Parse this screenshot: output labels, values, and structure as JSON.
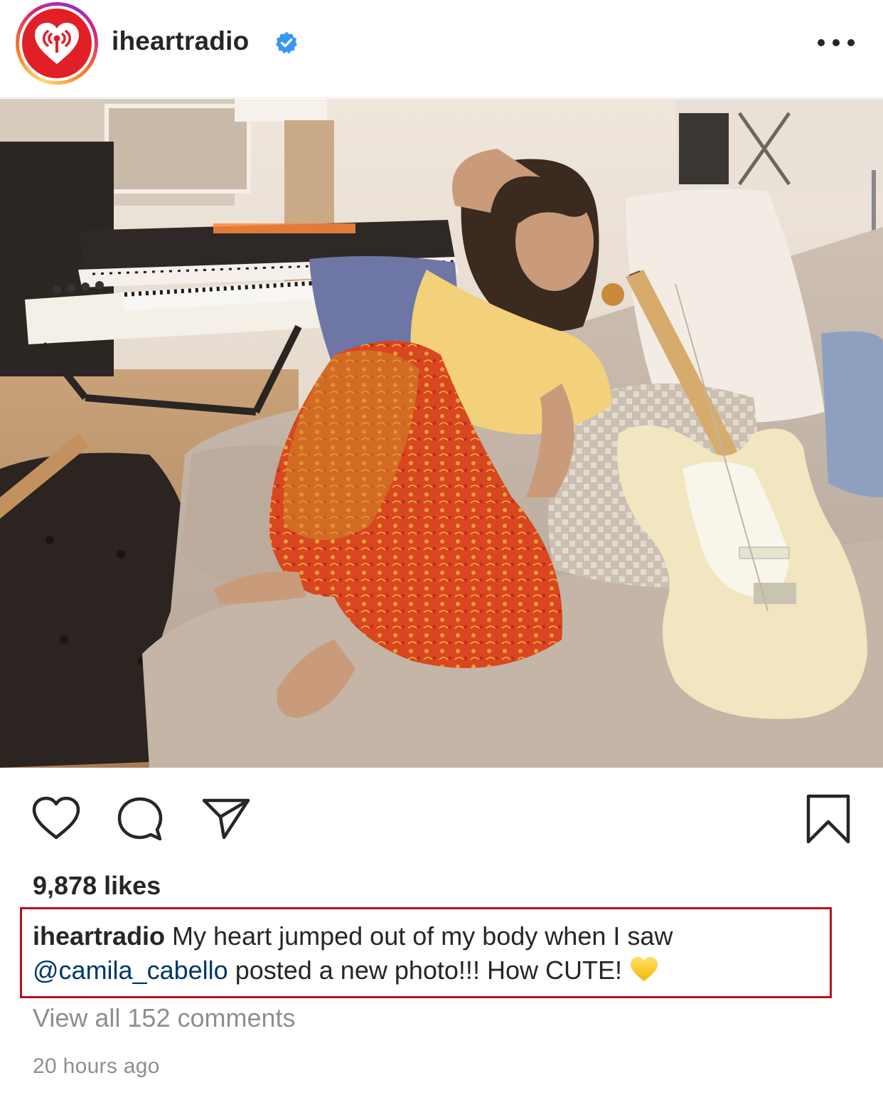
{
  "header": {
    "username": "iheartradio",
    "verified_icon": "verified-badge-icon",
    "more_icon": "more-options-icon"
  },
  "post": {
    "image_alt": "Woman in yellow top and red patterned pants sitting on a couch next to a cream electric guitar, keyboards in the background"
  },
  "actions": {
    "like_icon": "heart-icon",
    "comment_icon": "comment-icon",
    "share_icon": "send-icon",
    "save_icon": "bookmark-icon"
  },
  "likes": "9,878 likes",
  "caption": {
    "username": "iheartradio",
    "text_1": " My heart jumped out of my body when I saw",
    "mention": "@camila_cabello",
    "text_2": " posted a new photo!!! How CUTE!",
    "emoji_icon": "yellow-heart-emoji-icon"
  },
  "comments_link": "View all 152 comments",
  "timestamp": "20 hours ago",
  "colors": {
    "brand_red": "#e11f26",
    "highlight_border": "#b5121b",
    "verified_blue": "#3897f0",
    "mention_blue": "#00376b",
    "muted_text": "#8e8e8e"
  }
}
